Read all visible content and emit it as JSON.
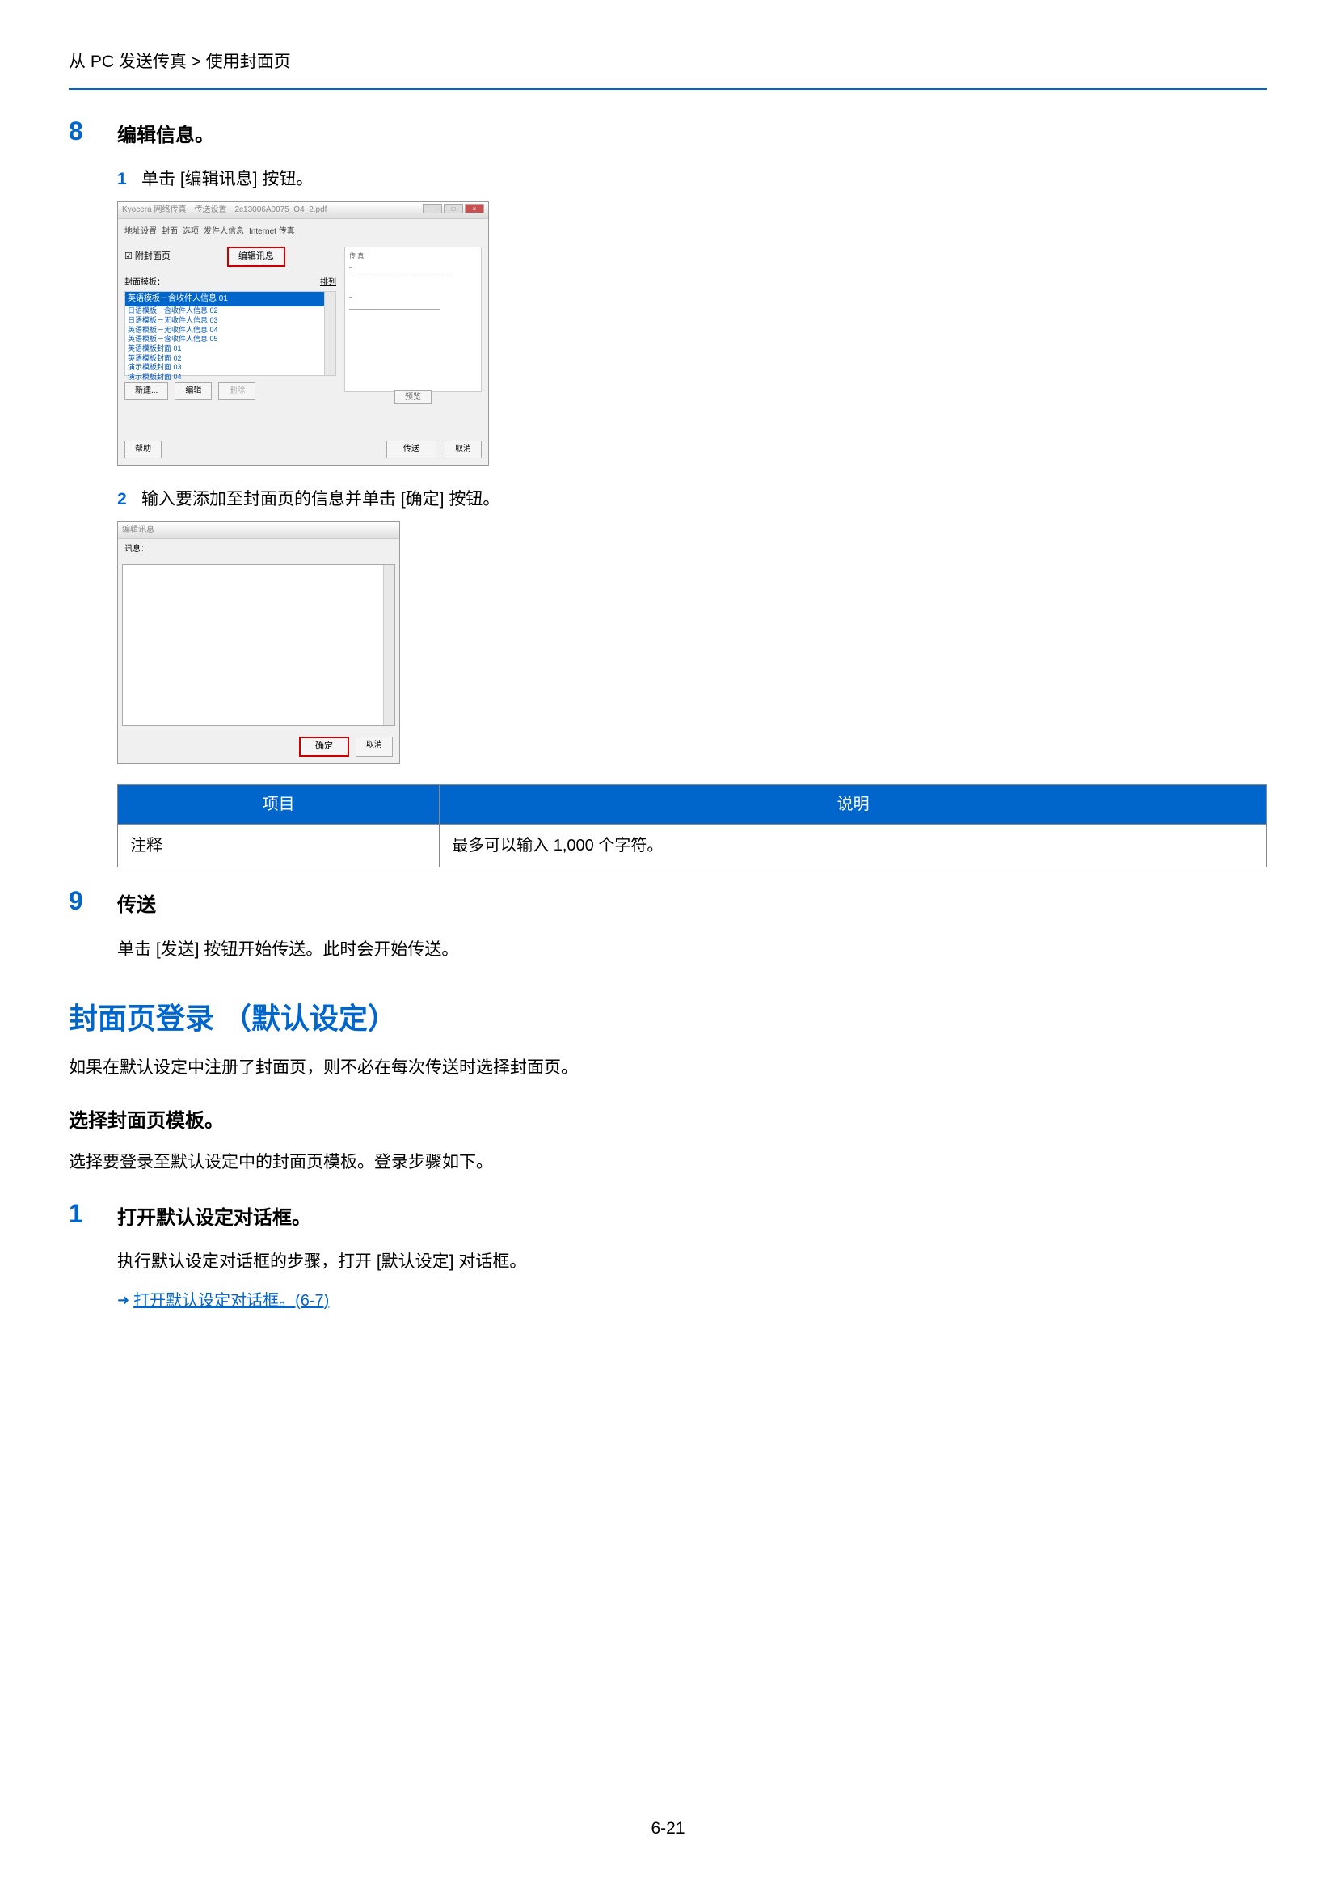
{
  "breadcrumb": "从 PC 发送传真 > 使用封面页",
  "step8": {
    "number": "8",
    "title": "编辑信息。",
    "sub1": {
      "num": "1",
      "text": "单击 [编辑讯息] 按钮。"
    },
    "sub2": {
      "num": "2",
      "text": "输入要添加至封面页的信息并单击 [确定] 按钮。"
    }
  },
  "dialog1": {
    "title": "Kyocera 网络传真　传送设置　2c13006A0075_O4_2.pdf",
    "tabs": [
      "地址设置",
      "封面",
      "选项",
      "发件人信息",
      "Internet 传真"
    ],
    "checkbox": "附封面页",
    "edit_btn": "编辑讯息",
    "template_label": "封面模板：",
    "templates": {
      "selected": "英语模板－含收件人信息 01",
      "items": [
        "日语模板－含收件人信息 02",
        "日语模板－无收件人信息 03",
        "英语模板－无收件人信息 04",
        "英语模板－含收件人信息 05",
        "英语模板封面 01",
        "英语模板封面 02",
        "演示模板封面 03",
        "演示模板封面 04"
      ]
    },
    "btn_new": "新建...",
    "btn_edit": "编辑",
    "btn_delete": "删除",
    "btn_preview": "预览",
    "btn_help": "帮助",
    "btn_send": "传送",
    "btn_cancel": "取消"
  },
  "dialog2": {
    "title": "编辑讯息",
    "label": "讯息：",
    "btn_ok": "确定",
    "btn_cancel": "取消"
  },
  "table": {
    "header1": "项目",
    "header2": "说明",
    "row1_col1": "注释",
    "row1_col2": "最多可以输入 1,000 个字符。"
  },
  "step9": {
    "number": "9",
    "title": "传送",
    "text": "单击 [发送] 按钮开始传送。此时会开始传送。"
  },
  "section": {
    "title": "封面页登录 （默认设定）",
    "text": "如果在默认设定中注册了封面页，则不必在每次传送时选择封面页。",
    "sub_title": "选择封面页模板。",
    "sub_text": "选择要登录至默认设定中的封面页模板。登录步骤如下。"
  },
  "step1": {
    "number": "1",
    "title": "打开默认设定对话框。",
    "text": "执行默认设定对话框的步骤，打开 [默认设定] 对话框。",
    "link": "打开默认设定对话框。(6-7)"
  },
  "page_number": "6-21"
}
